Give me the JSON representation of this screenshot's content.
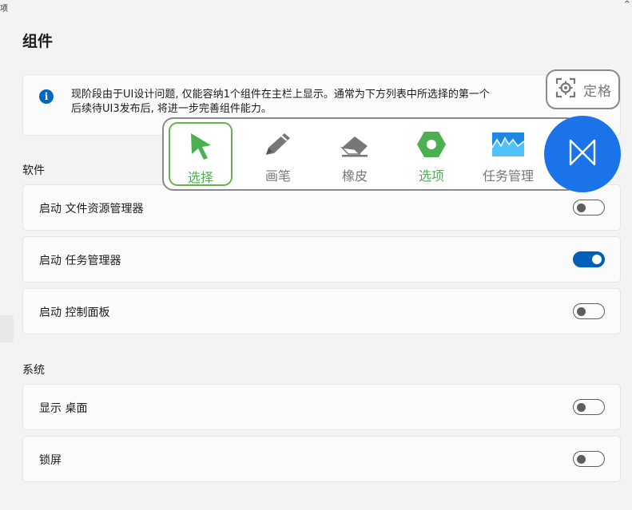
{
  "window": {
    "corner_left": "项",
    "corner_right": "^"
  },
  "page_title": "组件",
  "info": {
    "line1": "现阶段由于UI设计问题, 仅能容纳1个组件在主栏上显示。通常为下方列表中所选择的第一个",
    "line2": "后续待UI3发布后, 将进一步完善组件能力。"
  },
  "sections": [
    {
      "title": "软件",
      "items": [
        {
          "label": "启动 文件资源管理器",
          "on": false
        },
        {
          "label": "启动 任务管理器",
          "on": true
        },
        {
          "label": "启动 控制面板",
          "on": false
        }
      ]
    },
    {
      "title": "系统",
      "items": [
        {
          "label": "显示 桌面",
          "on": false
        },
        {
          "label": "锁屏",
          "on": false
        }
      ]
    }
  ],
  "position_button": {
    "label": "定格",
    "icon": "locate-icon"
  },
  "toolbar": {
    "tools": [
      {
        "label": "选择",
        "icon": "cursor-arrow-icon",
        "selected": true,
        "color": "#4caf50"
      },
      {
        "label": "画笔",
        "icon": "pen-icon",
        "selected": false,
        "color": "#777777"
      },
      {
        "label": "橡皮",
        "icon": "eraser-icon",
        "selected": false,
        "color": "#777777"
      },
      {
        "label": "选项",
        "icon": "hexagon-options-icon",
        "selected": false,
        "color": "#4caf50"
      },
      {
        "label": "任务管理",
        "icon": "task-manager-icon",
        "selected": false,
        "color": "#777777"
      }
    ]
  },
  "main_button": {
    "icon": "bowtie-icon",
    "color": "#1a73e8"
  }
}
